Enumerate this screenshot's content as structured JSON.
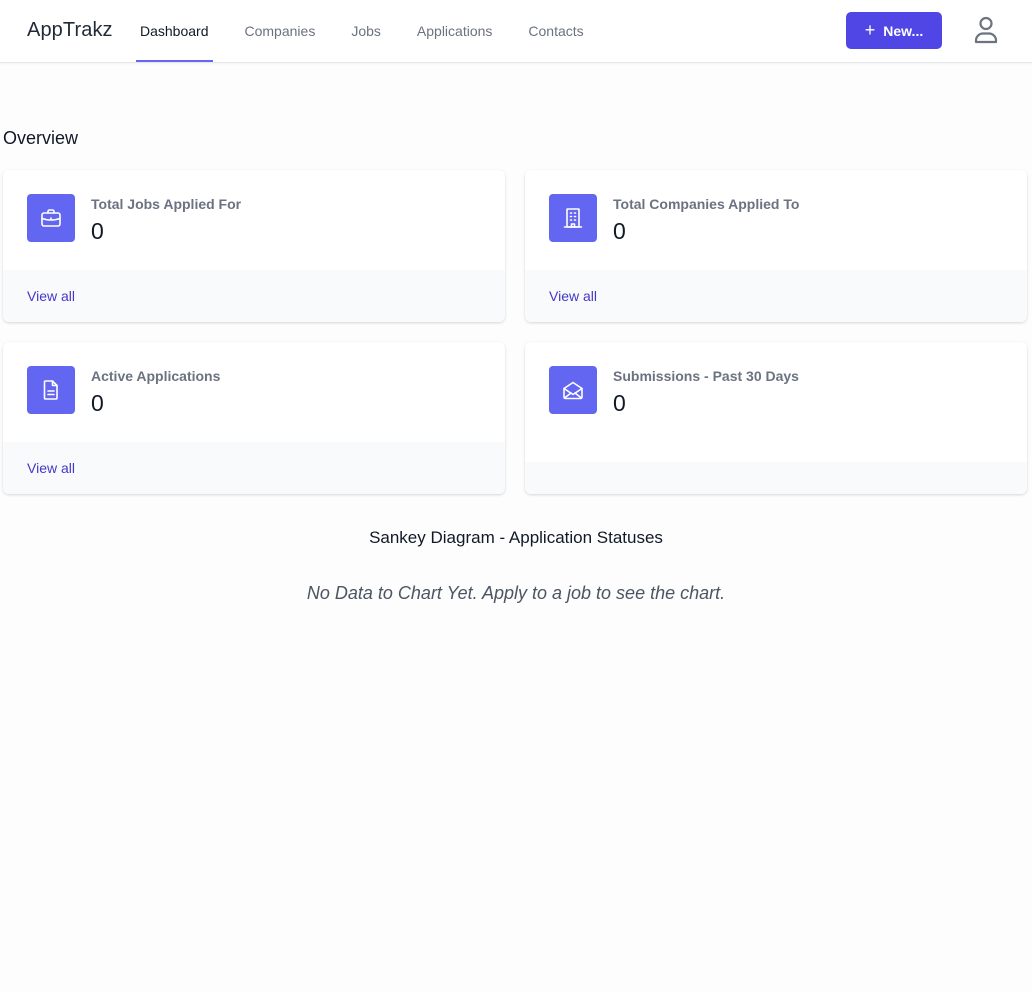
{
  "app": {
    "brand": "AppTrakz"
  },
  "nav": {
    "items": [
      {
        "label": "Dashboard",
        "active": true
      },
      {
        "label": "Companies"
      },
      {
        "label": "Jobs"
      },
      {
        "label": "Applications"
      },
      {
        "label": "Contacts"
      }
    ]
  },
  "header": {
    "new_button": "New...",
    "new_icon": "plus-icon",
    "user_icon": "user-icon"
  },
  "overview": {
    "title": "Overview",
    "cards": [
      {
        "label": "Total Jobs Applied For",
        "value": "0",
        "link": "View all",
        "icon": "briefcase-icon"
      },
      {
        "label": "Total Companies Applied To",
        "value": "0",
        "link": "View all",
        "icon": "building-icon"
      },
      {
        "label": "Active Applications",
        "value": "0",
        "link": "View all",
        "icon": "document-icon"
      },
      {
        "label": "Submissions - Past 30 Days",
        "value": "0",
        "icon": "mail-open-icon"
      }
    ]
  },
  "sankey": {
    "title": "Sankey Diagram - Application Statuses",
    "empty_message": "No Data to Chart Yet. Apply to a job to see the chart."
  },
  "colors": {
    "accent": "#6366f1",
    "button": "#4f46e5",
    "link": "#4338ca"
  }
}
